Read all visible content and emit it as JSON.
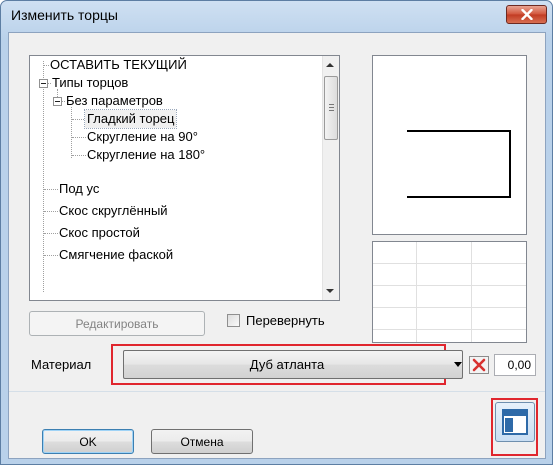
{
  "dialog": {
    "title": "Изменить торцы",
    "close_icon": "close-icon"
  },
  "tree": {
    "items": [
      {
        "label": "ОСТАВИТЬ ТЕКУЩИЙ"
      },
      {
        "label": "Типы торцов",
        "expanded": true
      },
      {
        "label": "Без параметров",
        "expanded": true
      },
      {
        "label": "Гладкий торец",
        "selected": true
      },
      {
        "label": "Скругление на 90°"
      },
      {
        "label": "Скругление на 180°"
      },
      {
        "label": "Под ус"
      },
      {
        "label": "Скос скруглённый"
      },
      {
        "label": "Скос простой"
      },
      {
        "label": "Смягчение фаской"
      }
    ]
  },
  "buttons": {
    "edit_label": "Редактировать",
    "ok_label": "OK",
    "cancel_label": "Отмена"
  },
  "flip": {
    "label": "Перевернуть",
    "checked": false
  },
  "material": {
    "label": "Материал",
    "value": "Дуб атланта",
    "number": "0,00"
  },
  "colors": {
    "highlight": "#e0262e",
    "close_button": "#c9452b",
    "clear_icon": "#d8312f"
  }
}
